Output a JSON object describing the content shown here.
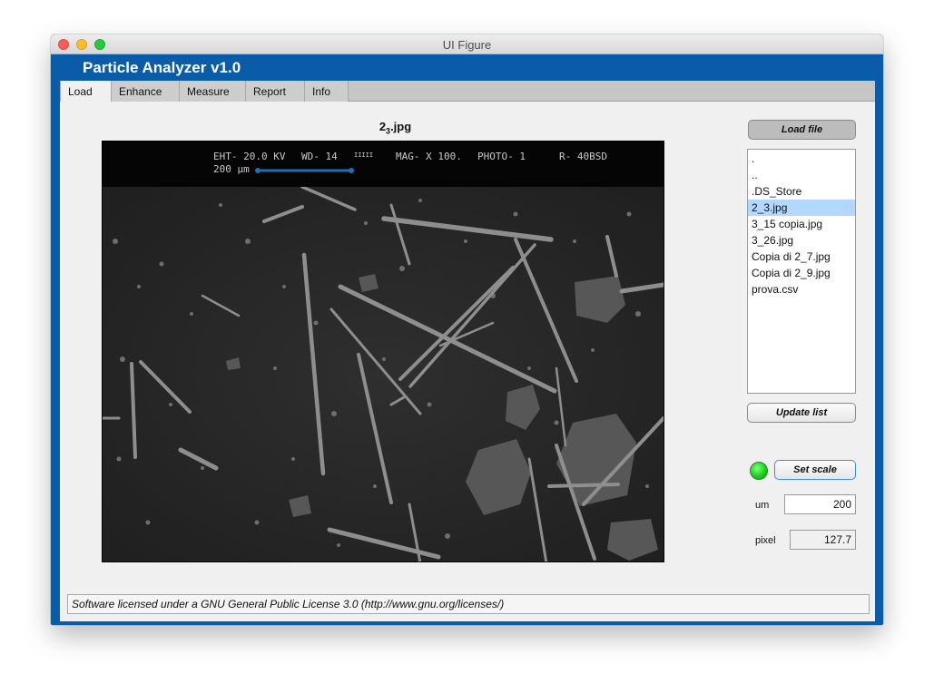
{
  "window": {
    "title": "UI Figure"
  },
  "app": {
    "title": "Particle Analyzer  v1.0"
  },
  "tabs": [
    {
      "label": "Load"
    },
    {
      "label": "Enhance"
    },
    {
      "label": "Measure"
    },
    {
      "label": "Report"
    },
    {
      "label": "Info"
    }
  ],
  "active_tab": "Load",
  "image": {
    "title_base": "2",
    "title_sub": "3",
    "title_ext": ".jpg",
    "sem_header": {
      "eht": "EHT- 20.0 KV",
      "wd": "WD- 14",
      "mag": "MAG- X 100.",
      "photo": "PHOTO- 1",
      "r": "R- 40BSD",
      "scale": "200 µm"
    }
  },
  "buttons": {
    "load_file": "Load file",
    "update_list": "Update list",
    "set_scale": "Set scale"
  },
  "file_list": {
    "items": [
      ".",
      "..",
      ".DS_Store",
      "2_3.jpg",
      "3_15 copia.jpg",
      "3_26.jpg",
      "Copia di 2_7.jpg",
      "Copia di 2_9.jpg",
      "prova.csv"
    ],
    "selected": "2_3.jpg"
  },
  "scale": {
    "um_label": "um",
    "um_value": "200",
    "pixel_label": "pixel",
    "pixel_value": "127.7",
    "lamp_color": "#19d219"
  },
  "status": {
    "text": "Software licensed under a GNU General Public License 3.0 (http://www.gnu.org/licenses/)"
  },
  "colors": {
    "header_blue": "#0a5ca8",
    "selection": "#b2d8ff"
  }
}
